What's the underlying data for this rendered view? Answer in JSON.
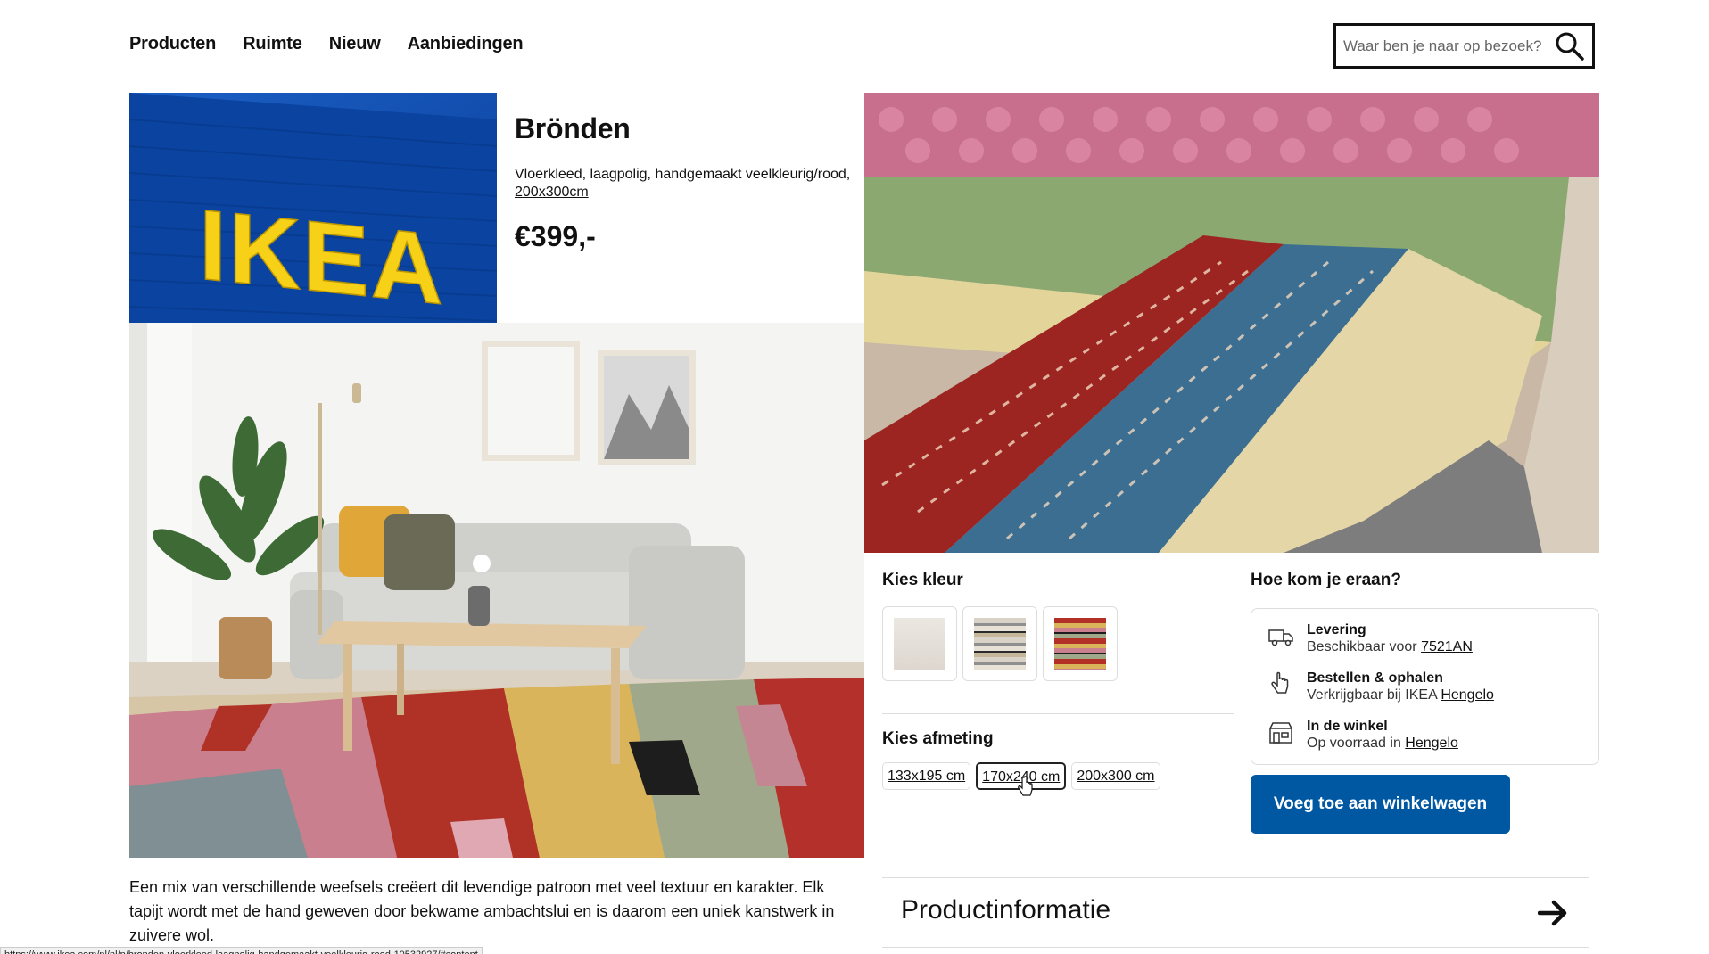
{
  "nav": {
    "items": [
      "Producten",
      "Ruimte",
      "Nieuw",
      "Aanbiedingen"
    ]
  },
  "search": {
    "placeholder": "Waar ben je naar op bezoek?",
    "icon": "search-icon"
  },
  "logo": {
    "text": "IKEA",
    "colors": {
      "blue": "#0a4fa8",
      "yellow": "#f7d117"
    }
  },
  "product": {
    "name": "Brönden",
    "description": "Vloerkleed, laagpolig, handgemaakt veelkleurig/rood,",
    "size": "200x300cm",
    "price": "€399,-"
  },
  "color_section": {
    "heading": "Kies kleur",
    "swatches": [
      "beige-rug",
      "grey-striped-rug",
      "multicolor-striped-rug"
    ]
  },
  "size_section": {
    "heading": "Kies afmeting",
    "options": [
      "133x195 cm",
      "170x240 cm",
      "200x300 cm"
    ],
    "selected": "170x240 cm"
  },
  "delivery": {
    "heading": "Hoe kom je eraan?",
    "rows": [
      {
        "title": "Levering",
        "text": "Beschikbaar voor",
        "link": "7521AN",
        "icon": "truck-icon"
      },
      {
        "title": "Bestellen & ophalen",
        "text": "Verkrijgbaar bij IKEA",
        "link": "Hengelo",
        "icon": "hand-pointer-icon"
      },
      {
        "title": "In de winkel",
        "text": "Op voorraad in",
        "link": "Hengelo",
        "icon": "store-icon"
      }
    ]
  },
  "cart": {
    "label": "Voeg toe aan winkelwagen",
    "color": "#0058a3"
  },
  "long_description": "Een mix van verschillende weefsels creëert dit levendige patroon met veel textuur en karakter. Elk tapijt wordt met de hand geweven door bekwame ambachtslui en is daarom een uniek kanstwerk in zuivere wol.",
  "product_info": {
    "label": "Productinformatie",
    "icon": "arrow-right-icon"
  },
  "statusbar": {
    "url": "https://www.ikea.com/nl/nl/p/bronden-vloerkleed-laagpolig-handgemaakt-veelkleurig-rood-10532927/#content"
  }
}
